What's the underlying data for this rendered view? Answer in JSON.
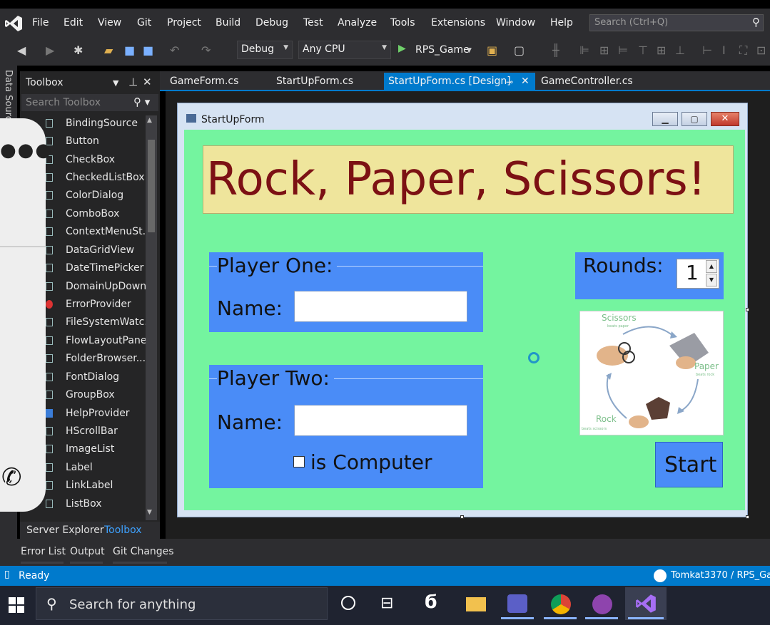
{
  "menu": {
    "items": [
      "File",
      "Edit",
      "View",
      "Git",
      "Project",
      "Build",
      "Debug",
      "Test",
      "Analyze",
      "Tools",
      "Extensions",
      "Window",
      "Help"
    ],
    "search_placeholder": "Search (Ctrl+Q)"
  },
  "toolbar": {
    "config": "Debug",
    "platform": "Any CPU",
    "run_target": "RPS_Game"
  },
  "left_strip": {
    "label": "Data Sources"
  },
  "toolbox": {
    "title": "Toolbox",
    "search_placeholder": "Search Toolbox",
    "items": [
      "BindingSource",
      "Button",
      "CheckBox",
      "CheckedListBox",
      "ColorDialog",
      "ComboBox",
      "ContextMenuSt...",
      "DataGridView",
      "DateTimePicker",
      "DomainUpDown",
      "ErrorProvider",
      "FileSystemWatc...",
      "FlowLayoutPanel",
      "FolderBrowser...",
      "FontDialog",
      "GroupBox",
      "HelpProvider",
      "HScrollBar",
      "ImageList",
      "Label",
      "LinkLabel",
      "ListBox"
    ],
    "tabs": [
      "Server Explorer",
      "Toolbox"
    ]
  },
  "doc_tabs": [
    "GameForm.cs",
    "StartUpForm.cs",
    "StartUpForm.cs [Design]",
    "GameController.cs"
  ],
  "form": {
    "title": "StartUpForm",
    "heading": "Rock, Paper, Scissors!",
    "player_one": {
      "title": "Player One:",
      "name_label": "Name:"
    },
    "player_two": {
      "title": "Player Two:",
      "name_label": "Name:",
      "computer_label": "is Computer"
    },
    "rounds": {
      "label": "Rounds:",
      "value": "1"
    },
    "image_labels": {
      "scissors": "Scissors",
      "scissors_sub": "beats paper",
      "paper": "Paper",
      "paper_sub": "beats rock",
      "rock": "Rock",
      "rock_sub": "beats scissors"
    },
    "start_button": "Start"
  },
  "bottom_tabs": [
    "Error List",
    "Output",
    "Git Changes"
  ],
  "status": {
    "ready": "Ready",
    "repo": "Tomkat3370 / RPS_Ga"
  },
  "taskbar": {
    "search_placeholder": "Search for anything"
  },
  "colors": {
    "accent": "#007acc",
    "form_bg": "#74f49f",
    "group_bg": "#4a8cf7",
    "title_text": "#7c1114",
    "title_bg": "#efe59c"
  }
}
